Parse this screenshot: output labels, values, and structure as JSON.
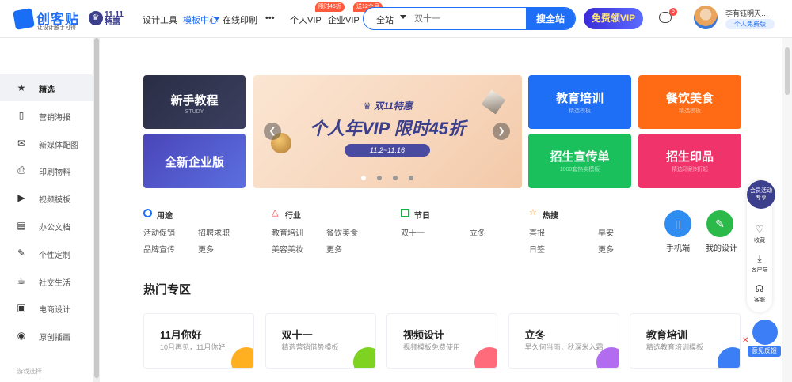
{
  "header": {
    "logo_name": "创客贴",
    "logo_slogan": "让设计触手可得",
    "promo_badge": "11.11特惠",
    "nav": [
      {
        "label": "设计工具"
      },
      {
        "label": "模板中心",
        "active": true
      },
      {
        "label": "在线印刷"
      },
      {
        "label": "•••"
      },
      {
        "label": "个人VIP",
        "badge": "限时45折"
      },
      {
        "label": "企业VIP",
        "badge": "送12个月"
      }
    ],
    "search": {
      "scope": "全站",
      "placeholder": "双十一",
      "button": "搜全站"
    },
    "vip_button": "免费领VIP",
    "message_count": "5",
    "user_name": "李有钰明天…",
    "user_tag": "个人免费版"
  },
  "sidebar": {
    "items": [
      {
        "label": "精选",
        "icon": "star-icon",
        "glyph": "★"
      },
      {
        "label": "营销海报",
        "icon": "phone-icon",
        "glyph": "▯"
      },
      {
        "label": "新媒体配图",
        "icon": "wechat-icon",
        "glyph": "✉"
      },
      {
        "label": "印刷物料",
        "icon": "printer-icon",
        "glyph": "⎙"
      },
      {
        "label": "视频模板",
        "icon": "video-icon",
        "glyph": "▶"
      },
      {
        "label": "办公文档",
        "icon": "document-icon",
        "glyph": "▤"
      },
      {
        "label": "个性定制",
        "icon": "pencil-icon",
        "glyph": "✎"
      },
      {
        "label": "社交生活",
        "icon": "cup-icon",
        "glyph": "☕"
      },
      {
        "label": "电商设计",
        "icon": "shop-icon",
        "glyph": "▣"
      },
      {
        "label": "原创插画",
        "icon": "palette-icon",
        "glyph": "◉"
      }
    ],
    "more": "游戏选择"
  },
  "cards": {
    "left_top": {
      "title": "新手教程",
      "sub": "STUDY"
    },
    "left_bottom": {
      "title": "全新企业版"
    },
    "banner": {
      "mark": "♛ 双11特惠",
      "title": "个人年VIP 限时45折",
      "dates": "11.2~11.16"
    },
    "right": [
      {
        "title": "教育培训",
        "sub": "精选模板",
        "color": "#1e6ef6"
      },
      {
        "title": "餐饮美食",
        "sub": "精选模板",
        "color": "#ff6a14"
      },
      {
        "title": "招生宣传单",
        "sub": "1000套热卖模板",
        "color": "#19c05c"
      },
      {
        "title": "招生印品",
        "sub": "精选印刷9折起",
        "color": "#f0336a"
      }
    ]
  },
  "categories": [
    {
      "title": "用途",
      "links": [
        "活动促销",
        "招聘求职",
        "品牌宣传",
        "更多"
      ],
      "color": "#1e6ef6"
    },
    {
      "title": "行业",
      "links": [
        "教育培训",
        "餐饮美食",
        "美容美妆",
        "更多"
      ],
      "color": "#f23d3d"
    },
    {
      "title": "节日",
      "links": [
        "双十一",
        "立冬"
      ],
      "color": "#19b04b"
    },
    {
      "title": "热搜",
      "links": [
        "喜报",
        "早安",
        "日签",
        "更多"
      ],
      "color": "#ff8a00"
    }
  ],
  "quick_actions": [
    {
      "label": "手机端",
      "icon": "mobile-icon",
      "glyph": "▯",
      "color": "#2f8cf0"
    },
    {
      "label": "我的设计",
      "icon": "pencil-icon",
      "glyph": "✎",
      "color": "#2bb94a"
    }
  ],
  "hot": {
    "title": "热门专区",
    "items": [
      {
        "title": "11月你好",
        "sub": "10月再见，11月你好",
        "color": "#ffb020"
      },
      {
        "title": "双十一",
        "sub": "精选营销借势模板",
        "color": "#7ed321"
      },
      {
        "title": "视频设计",
        "sub": "视频模板免费使用",
        "color": "#ff6b7a"
      },
      {
        "title": "立冬",
        "sub": "早久何当雨，秋深米入霜",
        "color": "#b26cf0"
      },
      {
        "title": "教育培训",
        "sub": "精选教育培训模板",
        "color": "#3b7ef6"
      }
    ]
  },
  "tools": {
    "promo": "会员活动",
    "promo_sub": "专享",
    "items": [
      {
        "label": "收藏",
        "icon": "heart-icon",
        "glyph": "♡"
      },
      {
        "label": "客户端",
        "icon": "download-icon",
        "glyph": "⤓"
      },
      {
        "label": "客服",
        "icon": "headset-icon",
        "glyph": "☊"
      }
    ],
    "feedback": "意见反馈"
  }
}
